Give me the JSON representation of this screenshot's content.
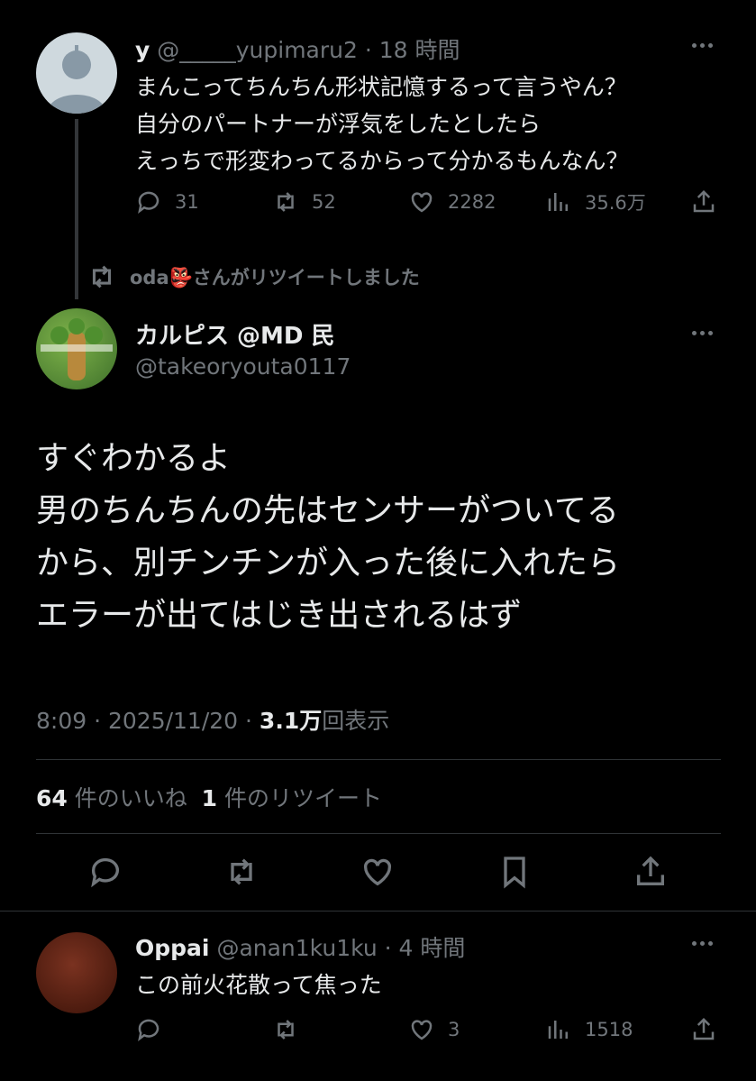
{
  "tweet1": {
    "name": "y",
    "handle": "@_____yupimaru2",
    "time": "· 18 時間",
    "lines": [
      "まんこってちんちん形状記憶するって言うやん？",
      "自分のパートナーが浮気をしたとしたら",
      "えっちで形変わってるからって分かるもんなん？"
    ],
    "replies": "31",
    "retweets": "52",
    "likes": "2282",
    "views": "35.6万"
  },
  "retweet_banner": {
    "user": "oda",
    "emoji": "👺",
    "text": "さんがリツイートしました"
  },
  "main": {
    "name": "カルピス @MD 民",
    "handle": "@takeoryouta0117",
    "lines": [
      "すぐわかるよ",
      "男のちんちんの先はセンサーがついてる",
      "から、別チンチンが入った後に入れたら",
      "エラーが出てはじき出されるはず"
    ],
    "time": "8:09 · 2025/11/20 · ",
    "views_count": "3.1万",
    "views_label": "回表示",
    "likes_count": "64",
    "likes_label": "件のいいね",
    "rt_count": "1",
    "rt_label": "件のリツイート"
  },
  "reply": {
    "name": "Oppai",
    "handle": "@anan1ku1ku",
    "time": "· 4 時間",
    "text": "この前火花散って焦った",
    "replies": "",
    "retweets": "",
    "likes": "3",
    "views": "1518"
  }
}
